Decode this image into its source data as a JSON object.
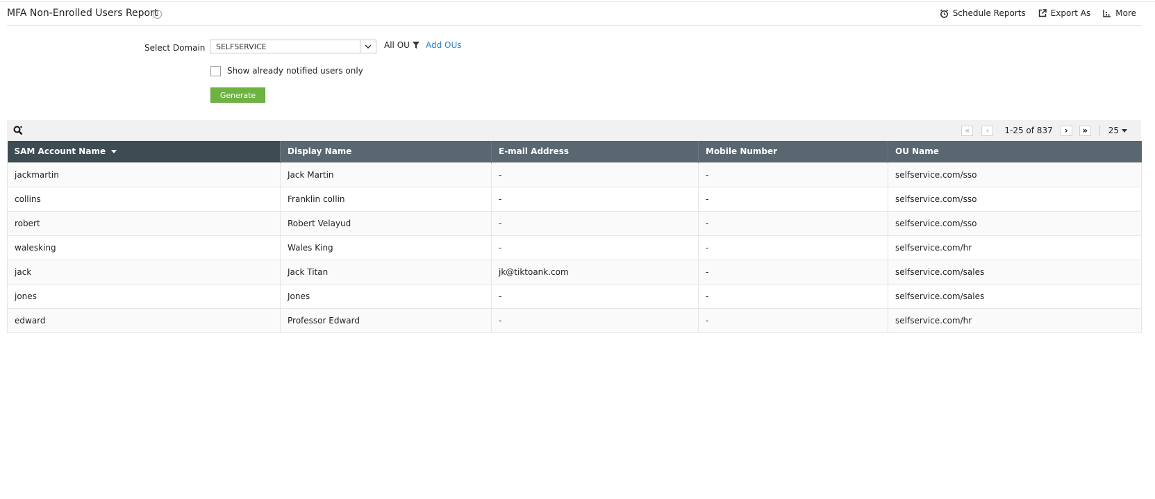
{
  "header": {
    "title": "MFA Non-Enrolled Users Report",
    "help_glyph": "?",
    "actions": [
      {
        "label": "Schedule Reports",
        "icon": "alarm-clock-icon"
      },
      {
        "label": "Export As",
        "icon": "export-icon"
      },
      {
        "label": "More",
        "icon": "more-icon"
      }
    ]
  },
  "form": {
    "domain_label": "Select Domain",
    "domain_value": "SELFSERVICE",
    "ou_label": "All OU",
    "add_ous_label": "Add OUs",
    "notified_label": "Show already notified users only",
    "notified_checked": false,
    "generate_label": "Generate"
  },
  "pager": {
    "first": "«",
    "prev": "‹",
    "range": "1-25 of 837",
    "next": "›",
    "last": "»",
    "page_size": "25"
  },
  "table": {
    "columns": [
      "SAM Account Name",
      "Display Name",
      "E-mail Address",
      "Mobile Number",
      "OU Name"
    ],
    "sorted_column": "SAM Account Name",
    "rows": [
      [
        "jackmartin",
        "Jack Martin",
        "-",
        "-",
        "selfservice.com/sso"
      ],
      [
        "collins",
        "Franklin collin",
        "-",
        "-",
        "selfservice.com/sso"
      ],
      [
        "robert",
        "Robert Velayud",
        "-",
        "-",
        "selfservice.com/sso"
      ],
      [
        "walesking",
        "Wales King",
        "-",
        "-",
        "selfservice.com/hr"
      ],
      [
        "jack",
        "Jack Titan",
        "jk@tiktoank.com",
        "-",
        "selfservice.com/sales"
      ],
      [
        "jones",
        "Jones",
        "-",
        "-",
        "selfservice.com/sales"
      ],
      [
        "edward",
        "Professor Edward",
        "-",
        "-",
        "selfservice.com/hr"
      ]
    ]
  },
  "colors": {
    "header_bg": "#586770",
    "header_sorted_bg": "#3d4b53",
    "generate_bg": "#6cb33f",
    "link": "#2a7fc6"
  }
}
